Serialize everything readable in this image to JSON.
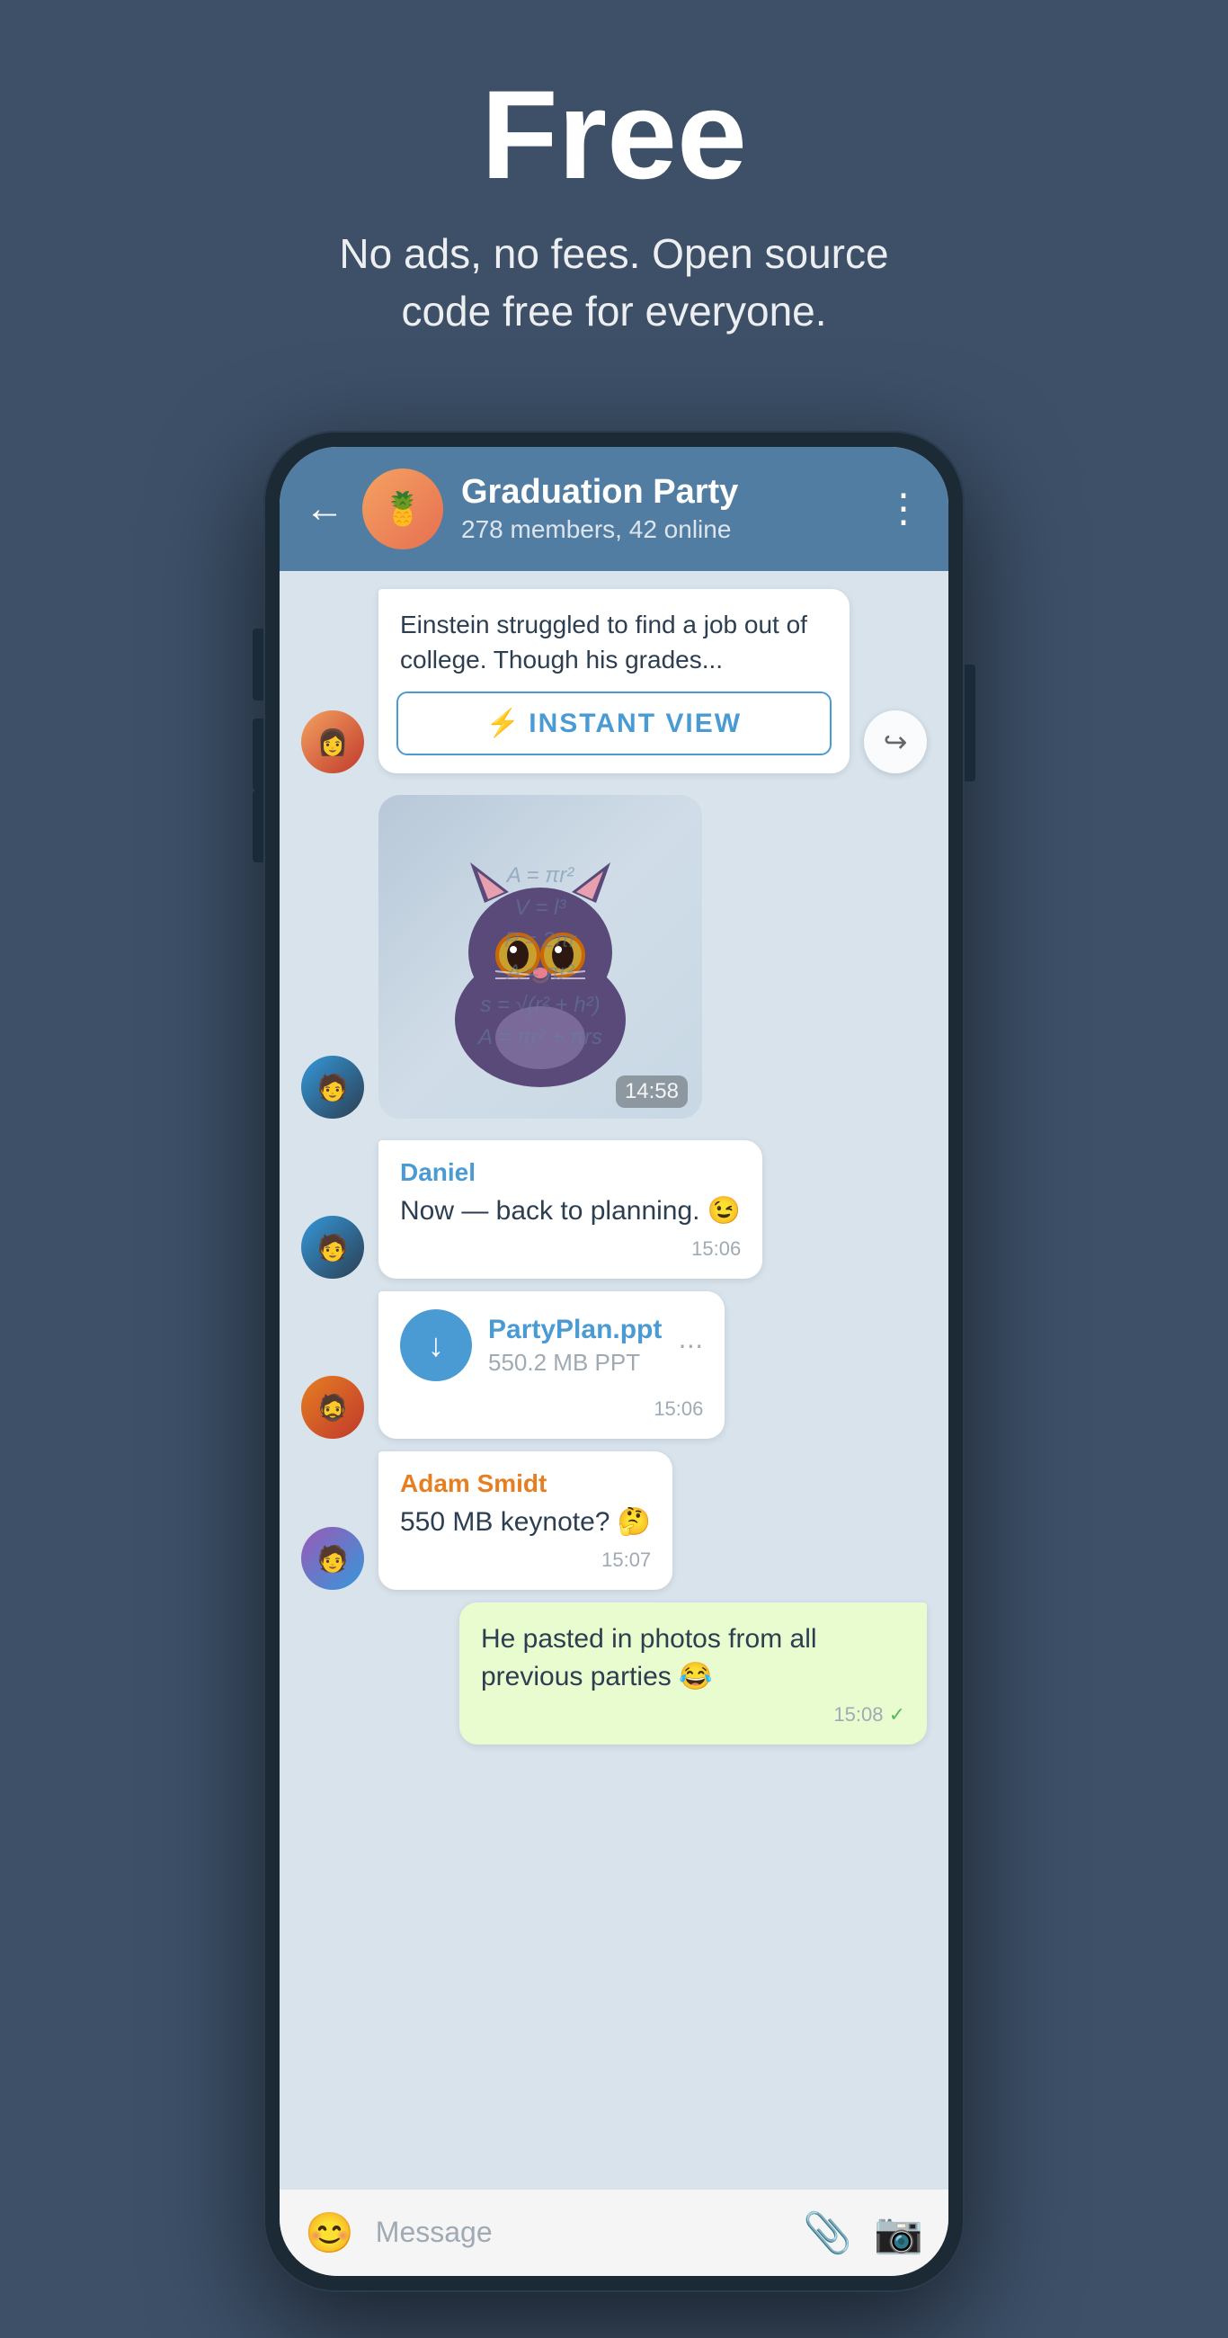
{
  "hero": {
    "title": "Free",
    "subtitle": "No ads, no fees. Open source code free for everyone."
  },
  "chat": {
    "group_name": "Graduation Party",
    "group_meta": "278 members, 42 online",
    "back_label": "←",
    "more_label": "⋮"
  },
  "messages": [
    {
      "id": "article",
      "type": "article",
      "text": "Einstein struggled to find a job out of college. Though his grades...",
      "instant_view_label": "INSTANT VIEW"
    },
    {
      "id": "sticker",
      "type": "sticker",
      "time": "14:58"
    },
    {
      "id": "daniel1",
      "type": "incoming",
      "sender": "Daniel",
      "text": "Now — back to planning. 😉",
      "time": "15:06"
    },
    {
      "id": "file1",
      "type": "file",
      "filename": "PartyPlan.ppt",
      "filesize": "550.2 MB PPT",
      "time": "15:06"
    },
    {
      "id": "adam1",
      "type": "incoming",
      "sender": "Adam Smidt",
      "sender_color": "orange",
      "text": "550 MB keynote? 🤔",
      "time": "15:07"
    },
    {
      "id": "outgoing1",
      "type": "outgoing",
      "text": "He pasted in photos from all previous parties 😂",
      "time": "15:08",
      "check": "✓"
    }
  ],
  "input": {
    "placeholder": "Message",
    "emoji_icon": "😊",
    "attach_icon": "📎",
    "camera_icon": "📷"
  },
  "math_formula": "s = √(r² + h²)\nA = πr² + πrs",
  "colors": {
    "bg": "#3d5068",
    "header_bg": "#527da3",
    "chat_bg": "#d8e3ec",
    "bubble_outgoing": "#e8fcd0",
    "sender_blue": "#4a9bd4",
    "sender_orange": "#e67e22"
  }
}
